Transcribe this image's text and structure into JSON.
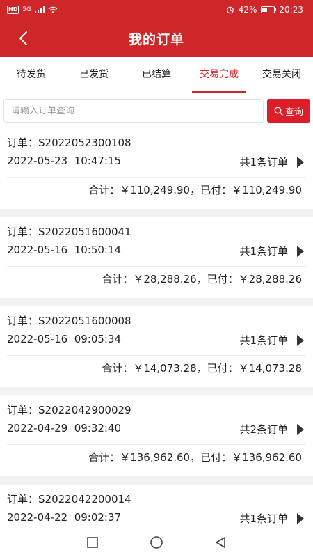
{
  "status_bar": {
    "network_label": "HD",
    "signal_label": "5G",
    "battery": "42%",
    "battery_level": 0.42,
    "time": "20:23"
  },
  "header": {
    "title": "我的订单",
    "back_icon": "chevron-left-icon"
  },
  "tabs": [
    {
      "label": "待发货",
      "active": false
    },
    {
      "label": "已发货",
      "active": false
    },
    {
      "label": "已结算",
      "active": false
    },
    {
      "label": "交易完成",
      "active": true
    },
    {
      "label": "交易关闭",
      "active": false
    }
  ],
  "search": {
    "placeholder": "请输入订单查询",
    "value": "",
    "button_label": "查询",
    "icon": "search-icon"
  },
  "orders": [
    {
      "order_no": "订单：S2022052300108",
      "date": "2022-05-23  10:47:15",
      "count": "共1条订单",
      "totals": "合计：￥110,249.90，已付：￥110,249.90"
    },
    {
      "order_no": "订单：S2022051600041",
      "date": "2022-05-16  10:50:14",
      "count": "共1条订单",
      "totals": "合计：￥28,288.26，已付：￥28,288.26"
    },
    {
      "order_no": "订单：S2022051600008",
      "date": "2022-05-16  09:05:34",
      "count": "共1条订单",
      "totals": "合计：￥14,073.28，已付：￥14,073.28"
    },
    {
      "order_no": "订单：S2022042900029",
      "date": "2022-04-29  09:32:40",
      "count": "共2条订单",
      "totals": "合计：￥136,962.60，已付：￥136,962.60"
    },
    {
      "order_no": "订单：S2022042200014",
      "date": "2022-04-22  09:02:37",
      "count": "共1条订单",
      "totals": ""
    }
  ],
  "colors": {
    "brand_red": "#cf262a",
    "button_red": "#dc1e28"
  }
}
